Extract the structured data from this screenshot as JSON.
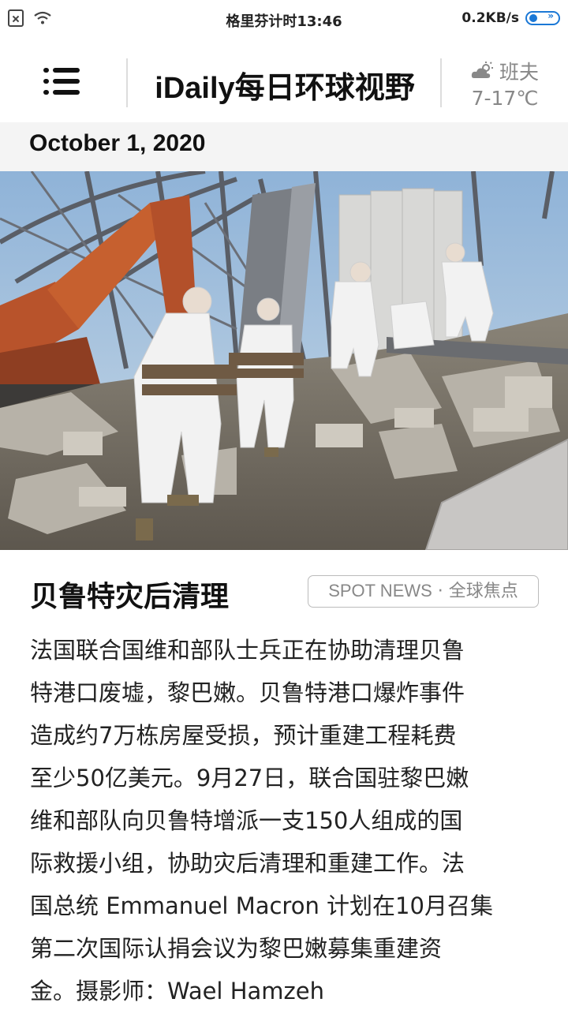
{
  "status_bar": {
    "center_text": "格里芬计时13:46",
    "speed": "0.2KB/s",
    "battery_label": "»"
  },
  "header": {
    "brand_en": "iDaily",
    "brand_cn": "每日环球视野",
    "weather": {
      "city": "班夫",
      "temp": "7-17℃",
      "icon": "partly-cloudy-icon"
    }
  },
  "date": "October 1, 2020",
  "photo": {
    "description_icon": "photo"
  },
  "article": {
    "title": "贝鲁特灾后清理",
    "category_en": "SPOT NEWS",
    "category_sep": " · ",
    "category_cn": "全球焦点",
    "body_lines": [
      "法国联合国维和部队士兵正在协助清理贝鲁",
      "特港口废墟，黎巴嫩。贝鲁特港口爆炸事件",
      "造成约7万栋房屋受损，预计重建工程耗费",
      "至少50亿美元。9月27日，联合国驻黎巴嫩",
      "维和部队向贝鲁特增派一支150人组成的国",
      "际救援小组，协助灾后清理和重建工作。法",
      "国总统 Emmanuel Macron 计划在10月召集",
      "第二次国际认捐会议为黎巴嫩募集重建资",
      "金。摄影师：Wael Hamzeh"
    ]
  },
  "colors": {
    "accent": "#1b78d6",
    "date_band": "#f4f4f4",
    "muted": "#888888"
  }
}
